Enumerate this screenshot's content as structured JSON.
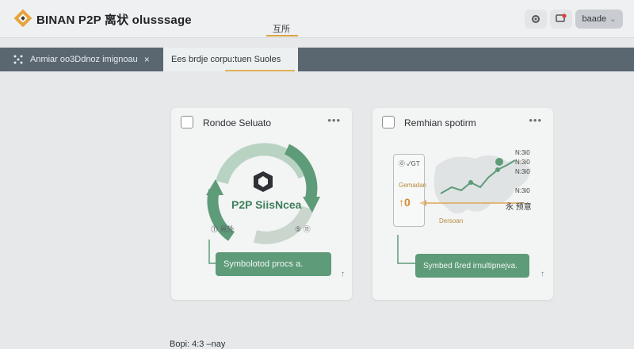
{
  "header": {
    "app_title": "BINAN P2P 离状 olusssage",
    "center_tab": "互所",
    "user_button_label": "baade",
    "user_button_caret": "⌄"
  },
  "tabs": [
    {
      "label": "Anmiar oo3Ddnoz imignoau",
      "close": "×"
    },
    {
      "label": "Ees brdje corpu:tuen Suoles"
    }
  ],
  "cards": [
    {
      "title": "Rondoe Seluato",
      "menu": "•••",
      "center_label": "P2P SiisNcea",
      "left_caption": "⓵ 晃外",
      "right_caption": "⑤ ⑪",
      "action_label": "Symbolotod procs a.",
      "arrow": "↑"
    },
    {
      "title": "Remhian spotirm",
      "menu": "•••",
      "panel_top": "⓪ ✓GT",
      "panel_mid": "Gemadan",
      "panel_value": "↑0",
      "panel_bottom": "Dersoan",
      "map_labels": [
        "N:3i0",
        "N:3i0",
        "N:3i0",
        "N:3i0",
        "永 预意"
      ],
      "action_label": "Symbed ßred irnultipnejva.",
      "arrow": "↑"
    }
  ],
  "footer": {
    "text": "Bopi: 4:3 –nay"
  },
  "colors": {
    "brand": "#d9a441",
    "accent_green": "#5e9b79",
    "tabbar": "#5a6670"
  }
}
